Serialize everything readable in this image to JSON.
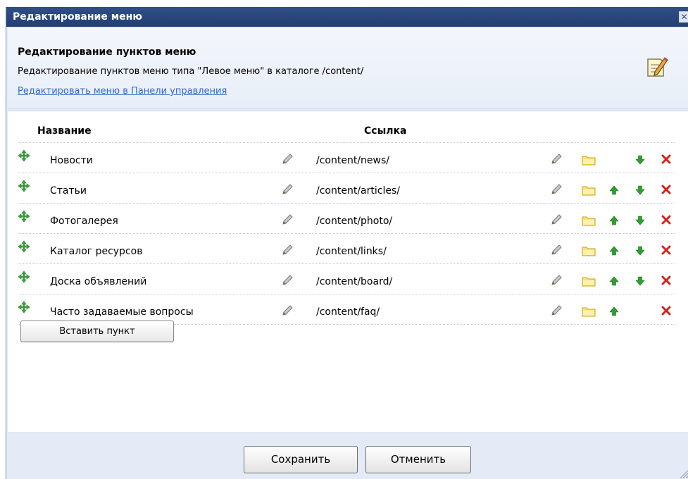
{
  "dialog": {
    "title": "Редактирование меню",
    "close_glyph": "✕"
  },
  "header": {
    "title": "Редактирование пунктов меню",
    "description": "Редактирование пунктов меню типа \"Левое меню\" в каталоге /content/",
    "link": "Редактировать меню в Панели управления",
    "icon": "edit-note-icon"
  },
  "table": {
    "col_name": "Название",
    "col_link": "Ссылка"
  },
  "items": [
    {
      "name": "Новости",
      "link": "/content/news/",
      "up": false,
      "down": true
    },
    {
      "name": "Статьи",
      "link": "/content/articles/",
      "up": true,
      "down": true
    },
    {
      "name": "Фотогалерея",
      "link": "/content/photo/",
      "up": true,
      "down": true
    },
    {
      "name": "Каталог ресурсов",
      "link": "/content/links/",
      "up": true,
      "down": true
    },
    {
      "name": "Доска объявлений",
      "link": "/content/board/",
      "up": true,
      "down": true
    },
    {
      "name": "Часто задаваемые вопросы",
      "link": "/content/faq/",
      "up": true,
      "down": false
    }
  ],
  "buttons": {
    "insert": "Вставить пункт",
    "save": "Сохранить",
    "cancel": "Отменить"
  },
  "colors": {
    "titlebar": "#2f4f86",
    "link": "#2f6cc7",
    "arrow_green": "#2da12d",
    "delete_red": "#d0241b",
    "folder_yellow": "#f5d53b"
  }
}
